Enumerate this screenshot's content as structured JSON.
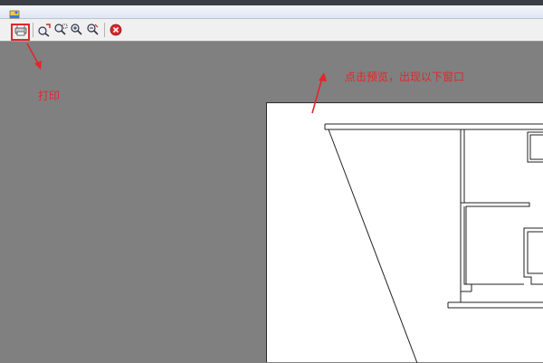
{
  "toolbar": {
    "buttons": [
      {
        "name": "print-button",
        "icon": "print-icon"
      },
      {
        "name": "zoom-to-fit-button",
        "icon": "zoom-fit-icon"
      },
      {
        "name": "zoom-window-button",
        "icon": "zoom-window-icon"
      },
      {
        "name": "zoom-in-button",
        "icon": "zoom-in-icon"
      },
      {
        "name": "zoom-out-button",
        "icon": "zoom-out-icon"
      },
      {
        "name": "close-preview-button",
        "icon": "close-icon"
      }
    ]
  },
  "annotations": {
    "print_label": "打印",
    "preview_label": "点击预览，出现以下窗口"
  },
  "colors": {
    "annotation_red": "#e3262b",
    "preview_background": "#808080",
    "paper": "#ffffff"
  }
}
